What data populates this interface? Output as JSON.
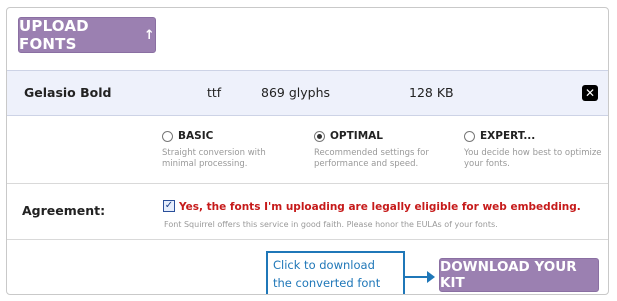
{
  "upload": {
    "label": "UPLOAD FONTS",
    "icon": "arrow-up-icon"
  },
  "file": {
    "name": "Gelasio Bold",
    "type": "ttf",
    "glyphs": "869 glyphs",
    "size": "128 KB",
    "remove_icon": "close-icon"
  },
  "options": [
    {
      "label": "BASIC",
      "desc": [
        "Straight conversion with",
        "minimal processing."
      ],
      "selected": false
    },
    {
      "label": "OPTIMAL",
      "desc": [
        "Recommended settings for",
        "performance and speed."
      ],
      "selected": true
    },
    {
      "label": "EXPERT...",
      "desc": [
        "You decide how best to optimize",
        "your fonts."
      ],
      "selected": false
    }
  ],
  "agreement": {
    "label": "Agreement:",
    "checked": true,
    "text": "Yes, the fonts I'm uploading are legally eligible for web embedding.",
    "subtext": "Font Squirrel offers this service in good faith. Please honor the EULAs of your fonts."
  },
  "callout": {
    "lines": [
      "Click to download",
      "the converted font"
    ]
  },
  "download": {
    "label": "DOWNLOAD YOUR KIT"
  },
  "colors": {
    "button": "#9b80b1",
    "callout": "#1f77b8",
    "agreement_text": "#c61a1a",
    "file_row_bg": "#eef1fb"
  }
}
